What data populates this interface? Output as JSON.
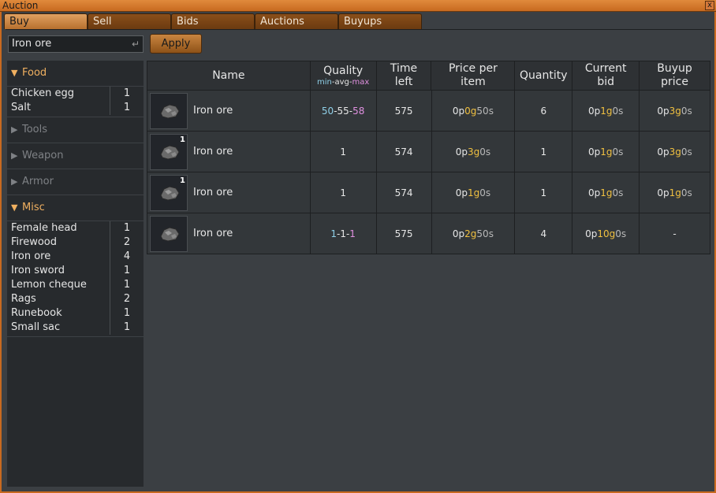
{
  "window": {
    "title": "Auction",
    "close_glyph": "x"
  },
  "tabs": [
    "Buy",
    "Sell",
    "Bids",
    "Auctions",
    "Buyups"
  ],
  "search": {
    "value": "Iron ore",
    "enter_icon": "↵"
  },
  "apply_label": "Apply",
  "categories": [
    {
      "label": "Food",
      "open": true,
      "items": [
        {
          "name": "Chicken egg",
          "count": "1"
        },
        {
          "name": "Salt",
          "count": "1"
        }
      ]
    },
    {
      "label": "Tools",
      "open": false
    },
    {
      "label": "Weapon",
      "open": false
    },
    {
      "label": "Armor",
      "open": false
    },
    {
      "label": "Misc",
      "open": true,
      "items": [
        {
          "name": "Female head",
          "count": "1"
        },
        {
          "name": "Firewood",
          "count": "2"
        },
        {
          "name": "Iron ore",
          "count": "4"
        },
        {
          "name": "Iron sword",
          "count": "1"
        },
        {
          "name": "Lemon cheque",
          "count": "1"
        },
        {
          "name": "Rags",
          "count": "2"
        },
        {
          "name": "Runebook",
          "count": "1"
        },
        {
          "name": "Small sac",
          "count": "1"
        }
      ]
    }
  ],
  "headers": {
    "name": "Name",
    "quality": "Quality",
    "quality_sub": [
      "min",
      "-avg-",
      "max"
    ],
    "time_left": [
      "Time",
      "left"
    ],
    "price": [
      "Price per",
      "item"
    ],
    "quantity": "Quantity",
    "current_bid": [
      "Current",
      "bid"
    ],
    "buyup": [
      "Buyup",
      "price"
    ]
  },
  "rows": [
    {
      "badge": "",
      "name": "Iron ore",
      "quality": [
        "50",
        "-55-",
        "58"
      ],
      "time_left": "575",
      "price": [
        "0p ",
        "0g",
        " 50s"
      ],
      "quantity": "6",
      "bid": [
        "0p ",
        "1g",
        " 0s"
      ],
      "buyup": [
        "0p ",
        "3g",
        " 0s"
      ]
    },
    {
      "badge": "1",
      "name": "Iron ore",
      "quality": [
        "1"
      ],
      "time_left": "574",
      "price": [
        "0p ",
        "3g",
        " 0s"
      ],
      "quantity": "1",
      "bid": [
        "0p ",
        "1g",
        " 0s"
      ],
      "buyup": [
        "0p ",
        "3g",
        " 0s"
      ]
    },
    {
      "badge": "1",
      "name": "Iron ore",
      "quality": [
        "1"
      ],
      "time_left": "574",
      "price": [
        "0p ",
        "1g",
        " 0s"
      ],
      "quantity": "1",
      "bid": [
        "0p ",
        "1g",
        " 0s"
      ],
      "buyup": [
        "0p ",
        "1g",
        " 0s"
      ]
    },
    {
      "badge": "",
      "name": "Iron ore",
      "quality": [
        "1",
        "-1-",
        "1"
      ],
      "time_left": "575",
      "price": [
        "0p ",
        "2g",
        " 50s"
      ],
      "quantity": "4",
      "bid": [
        "0p ",
        "10g",
        " 0s"
      ],
      "buyup": [
        "-"
      ]
    }
  ],
  "colors": {
    "accent": "#c86a20",
    "gold": "#f0c040",
    "min": "#8fd0e8",
    "max": "#e090e0"
  }
}
